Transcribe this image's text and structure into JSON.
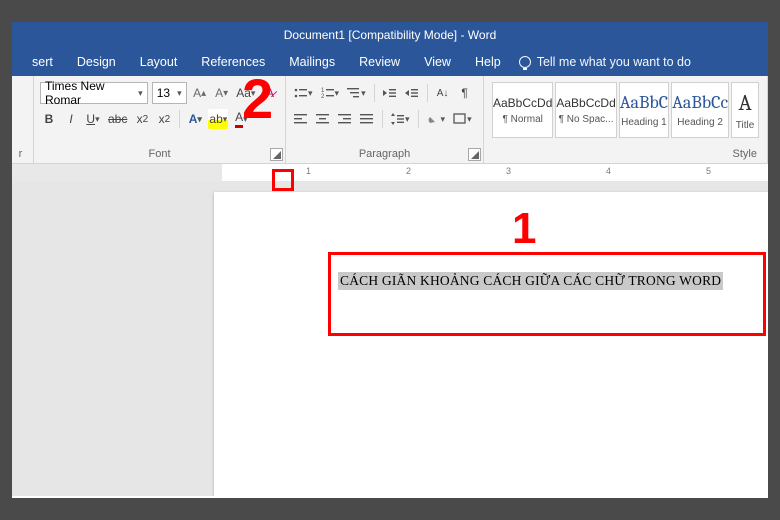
{
  "title": "Document1 [Compatibility Mode]  -  Word",
  "tabs": [
    "sert",
    "Design",
    "Layout",
    "References",
    "Mailings",
    "Review",
    "View",
    "Help"
  ],
  "tell_me": "Tell me what you want to do",
  "font": {
    "name": "Times New Romar",
    "size": "13",
    "group_label": "Font"
  },
  "clipboard": {
    "group_label": "r"
  },
  "paragraph": {
    "group_label": "Paragraph"
  },
  "styles": {
    "group_label": "Style",
    "items": [
      {
        "sample": "AaBbCcDd",
        "name": "¶ Normal"
      },
      {
        "sample": "AaBbCcDd",
        "name": "¶ No Spac..."
      },
      {
        "sample": "AaBbC",
        "name": "Heading 1"
      },
      {
        "sample": "AaBbCc",
        "name": "Heading 2"
      },
      {
        "sample": "A",
        "name": "Title"
      }
    ]
  },
  "ruler": {
    "numbers": [
      "1",
      "2",
      "3",
      "4",
      "5"
    ]
  },
  "document": {
    "selected_text": "CÁCH GIÃN KHOẢNG CÁCH GIỮA CÁC CHỮ TRONG WORD"
  },
  "annotations": {
    "one": "1",
    "two": "2"
  }
}
